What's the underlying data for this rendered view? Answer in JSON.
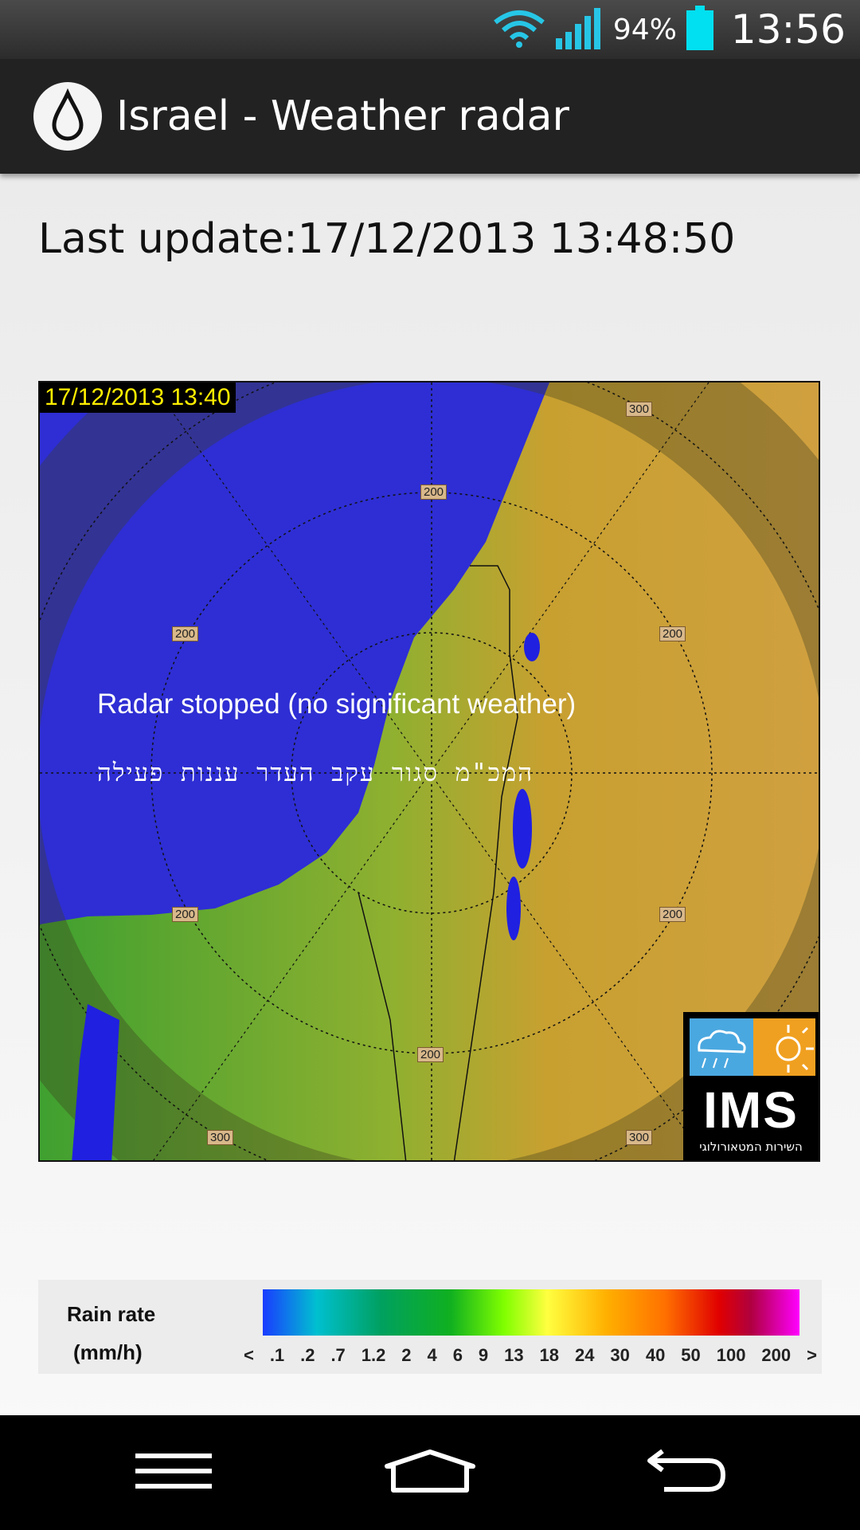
{
  "status_bar": {
    "battery_percent": "94%",
    "time": "13:56",
    "icons": [
      "wifi-icon",
      "signal-icon",
      "battery-icon"
    ]
  },
  "app_bar": {
    "title": "Israel - Weather radar",
    "icon": "water-drop-icon"
  },
  "last_update": {
    "label": "Last update:",
    "value": "17/12/2013 13:48:50"
  },
  "radar": {
    "timestamp": "17/12/2013 13:40",
    "message_en": "Radar stopped (no significant weather)",
    "message_he": "המכ\"מ סגור עקב העדר עננות פעילה",
    "range_labels": [
      "200",
      "200",
      "200",
      "200",
      "200",
      "200",
      "300",
      "300",
      "300"
    ],
    "logo": {
      "text": "IMS",
      "subtitle": "השירות המטאורולוגי"
    }
  },
  "legend": {
    "title_line1": "Rain rate",
    "title_line2": "(mm/h)",
    "ticks": [
      "<",
      ".1",
      ".2",
      ".7",
      "1.2",
      "2",
      "4",
      "6",
      "9",
      "13",
      "18",
      "24",
      "30",
      "40",
      "50",
      "100",
      "200",
      ">"
    ]
  },
  "nav_bar": {
    "icons": [
      "menu-icon",
      "home-icon",
      "back-icon"
    ]
  },
  "colors": {
    "sea": "#2e2ed4",
    "status_bar": "#333333",
    "action_bar": "#222222",
    "accent_battery": "#00e0f0"
  }
}
